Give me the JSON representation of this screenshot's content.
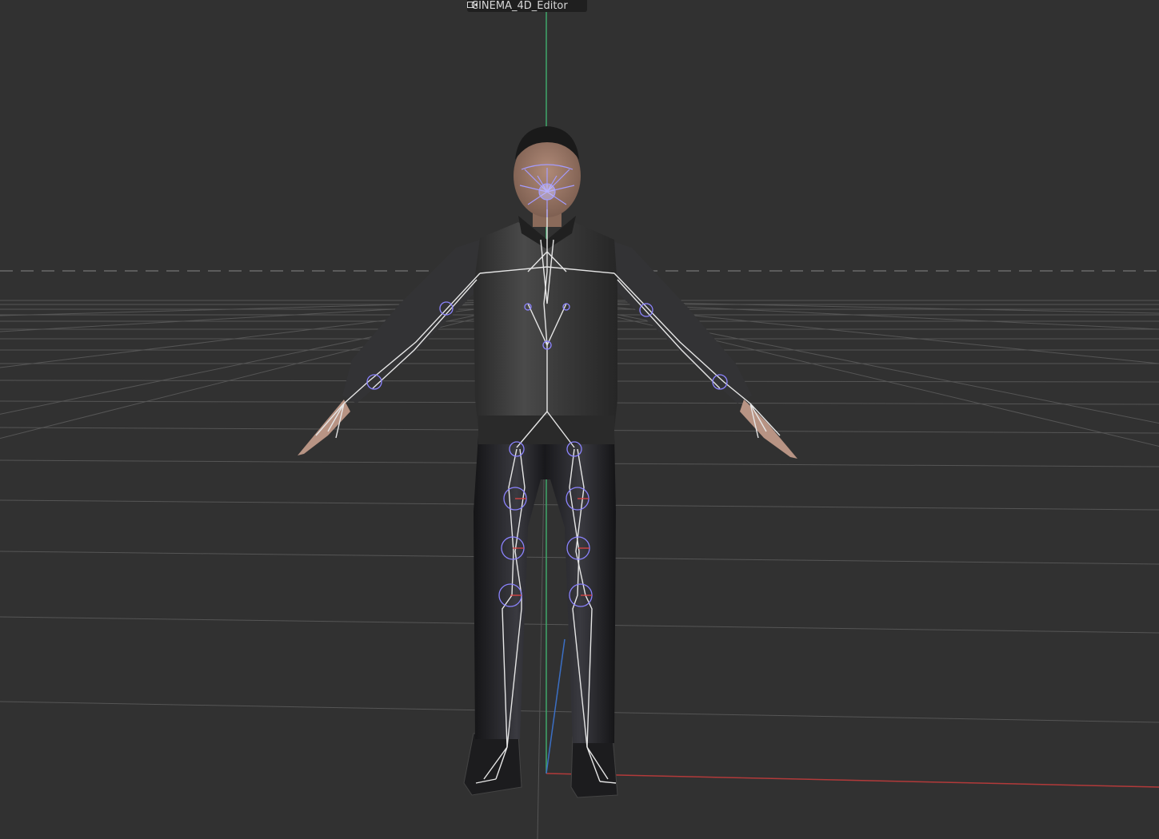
{
  "viewport": {
    "camera_label": "CINEMA_4D_Editor",
    "camera_icon": "camera-icon",
    "background_color": "#313131",
    "grid_color": "#595959",
    "axis_colors": {
      "x": "#b23a3a",
      "y": "#3fa86a",
      "z": "#3b6fc4"
    }
  },
  "scene": {
    "object": "rigged-character-t-pose",
    "joint_color": "#8c84ff",
    "bone_color": "#e6e6e6"
  }
}
